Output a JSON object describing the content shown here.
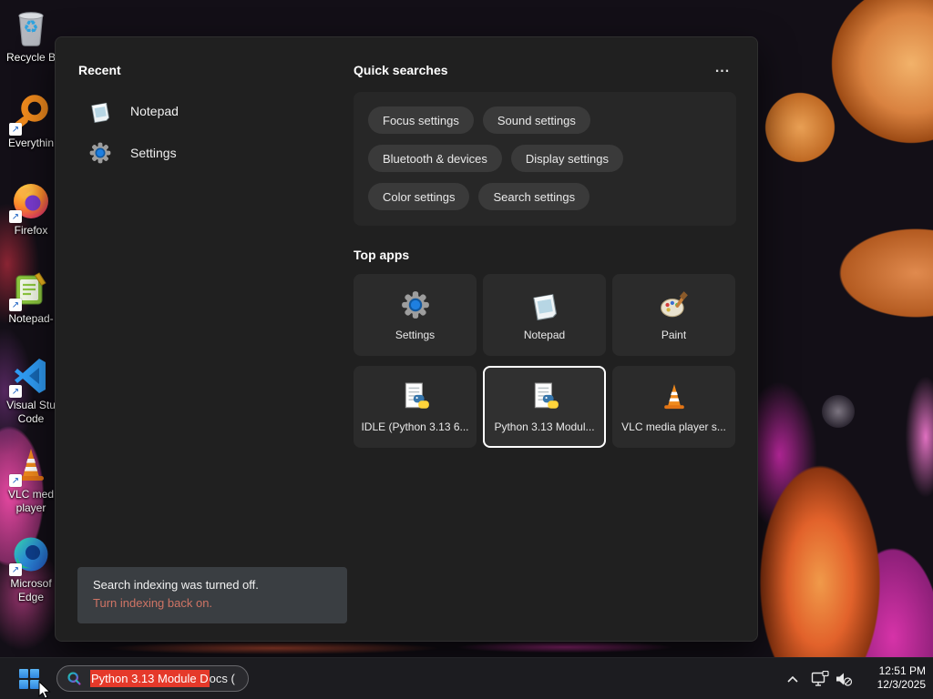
{
  "colors": {
    "panel_bg": "#202020",
    "tile_selected_border": "#ffffff",
    "taskbar_search_highlight": "#e5392a",
    "notice_link": "#cf7465",
    "accent_blue": "#2f86df"
  },
  "icons": {
    "recycle_glyph": "♻",
    "shortcut_arrow_glyph": "↗",
    "more_glyph": "..."
  },
  "desktop": {
    "icons": [
      {
        "name": "recycle-bin",
        "line1": "Recycle B"
      },
      {
        "name": "everything",
        "line1": "Everythin"
      },
      {
        "name": "firefox",
        "line1": "Firefox"
      },
      {
        "name": "notepad-plus-plus",
        "line1": "Notepad-"
      },
      {
        "name": "visual-studio-code",
        "line1": "Visual Stu",
        "line2": "Code"
      },
      {
        "name": "vlc-media-player",
        "line1": "VLC med",
        "line2": "player"
      },
      {
        "name": "microsoft-edge",
        "line1": "Microsof",
        "line2": "Edge"
      }
    ]
  },
  "search_panel": {
    "recent": {
      "title": "Recent",
      "items": [
        {
          "icon": "notepad-icon",
          "label": "Notepad"
        },
        {
          "icon": "settings-gear-icon",
          "label": "Settings"
        }
      ]
    },
    "quick_searches": {
      "title": "Quick searches",
      "rows": [
        [
          "Focus settings",
          "Sound settings"
        ],
        [
          "Bluetooth & devices",
          "Display settings"
        ],
        [
          "Color settings",
          "Search settings"
        ]
      ]
    },
    "top_apps": {
      "title": "Top apps",
      "tiles": [
        {
          "icon": "settings-gear-icon",
          "label": "Settings",
          "selected": false
        },
        {
          "icon": "notepad-icon",
          "label": "Notepad",
          "selected": false
        },
        {
          "icon": "paint-icon",
          "label": "Paint",
          "selected": false
        },
        {
          "icon": "python-doc-icon",
          "label": "IDLE (Python 3.13 6...",
          "selected": false
        },
        {
          "icon": "python-doc-icon",
          "label": "Python 3.13 Modul...",
          "selected": true
        },
        {
          "icon": "vlc-cone-icon",
          "label": "VLC media player s...",
          "selected": false
        }
      ]
    },
    "notice": {
      "message": "Search indexing was turned off.",
      "action": "Turn indexing back on."
    }
  },
  "taskbar": {
    "search": {
      "selected_text": "Python 3.13 Module D",
      "rest_text": "ocs ("
    },
    "clock": {
      "time": "12:51 PM",
      "date": "12/3/2025"
    }
  }
}
